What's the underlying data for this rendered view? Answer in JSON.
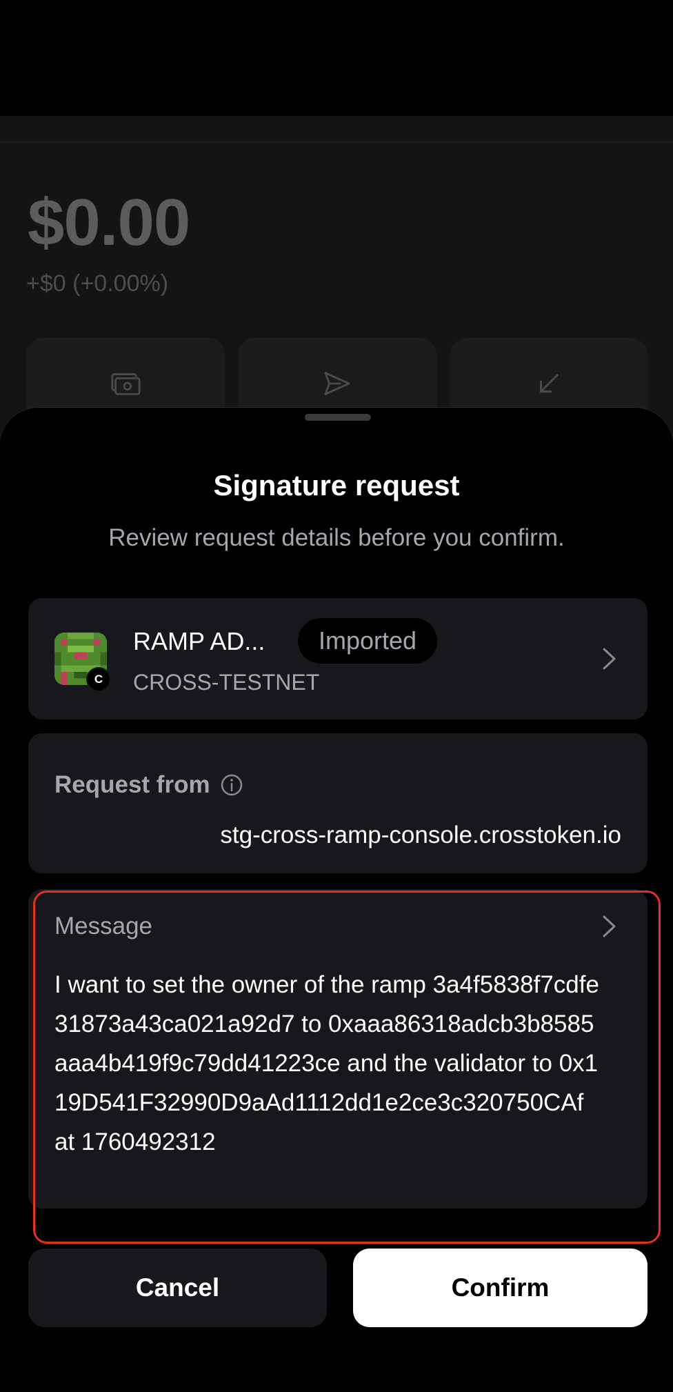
{
  "background": {
    "balance": "$0.00",
    "change": "+$0 (+0.00%)",
    "actions": [
      {
        "icon": "cash-icon"
      },
      {
        "icon": "send-icon"
      },
      {
        "icon": "receive-icon"
      }
    ]
  },
  "sheet": {
    "title": "Signature request",
    "subtitle": "Review request details before you confirm.",
    "account": {
      "name": "RAMP AD...",
      "badge": "Imported",
      "network": "CROSS-TESTNET",
      "avatar_badge": "C"
    },
    "request_from": {
      "label": "Request from",
      "value": "stg-cross-ramp-console.crosstoken.io"
    },
    "message": {
      "label": "Message",
      "text": "I want to set the owner of the ramp 3a4f5838f7cdfe31873a43ca021a92d7 to 0xaaa86318adcb3b8585aaa4b419f9c79dd41223ce and the validator to 0x119D541F32990D9aAd1112dd1e2ce3c320750CAf at 1760492312"
    },
    "cancel_label": "Cancel",
    "confirm_label": "Confirm"
  },
  "colors": {
    "highlight": "#e0321c",
    "card": "#17181b",
    "muted_text": "#a6a6b0"
  }
}
